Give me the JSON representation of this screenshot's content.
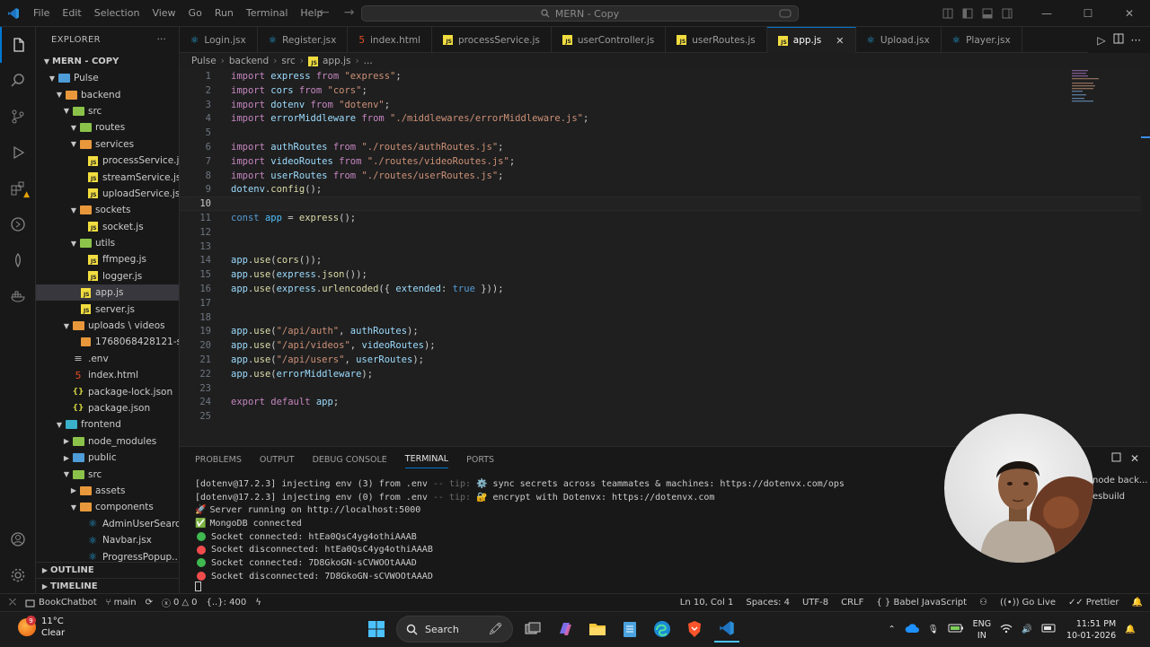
{
  "window": {
    "menu": [
      "File",
      "Edit",
      "Selection",
      "View",
      "Go",
      "Run",
      "Terminal",
      "Help"
    ],
    "search_text": "MERN - Copy"
  },
  "explorer": {
    "header": "EXPLORER",
    "root": "MERN - COPY",
    "rows": [
      {
        "label": "Pulse",
        "depth": 1,
        "type": "folder",
        "color": "blue",
        "open": true
      },
      {
        "label": "backend",
        "depth": 2,
        "type": "folder",
        "color": "orange",
        "open": true
      },
      {
        "label": "src",
        "depth": 3,
        "type": "folder",
        "color": "green",
        "open": true
      },
      {
        "label": "routes",
        "depth": 4,
        "type": "folder",
        "color": "green",
        "open": true
      },
      {
        "label": "services",
        "depth": 4,
        "type": "folder",
        "color": "orange",
        "open": true
      },
      {
        "label": "processService.js",
        "depth": 5,
        "type": "js"
      },
      {
        "label": "streamService.js",
        "depth": 5,
        "type": "js"
      },
      {
        "label": "uploadService.js",
        "depth": 5,
        "type": "js"
      },
      {
        "label": "sockets",
        "depth": 4,
        "type": "folder",
        "color": "orange",
        "open": true
      },
      {
        "label": "socket.js",
        "depth": 5,
        "type": "js"
      },
      {
        "label": "utils",
        "depth": 4,
        "type": "folder",
        "color": "green",
        "open": true
      },
      {
        "label": "ffmpeg.js",
        "depth": 5,
        "type": "js"
      },
      {
        "label": "logger.js",
        "depth": 5,
        "type": "js"
      },
      {
        "label": "app.js",
        "depth": 4,
        "type": "js",
        "selected": true
      },
      {
        "label": "server.js",
        "depth": 4,
        "type": "js"
      },
      {
        "label": "uploads \\ videos",
        "depth": 3,
        "type": "folder",
        "color": "orange",
        "open": true
      },
      {
        "label": "1768068428121-s...",
        "depth": 4,
        "type": "file"
      },
      {
        "label": ".env",
        "depth": 3,
        "type": "env"
      },
      {
        "label": "index.html",
        "depth": 3,
        "type": "html"
      },
      {
        "label": "package-lock.json",
        "depth": 3,
        "type": "json"
      },
      {
        "label": "package.json",
        "depth": 3,
        "type": "json"
      },
      {
        "label": "frontend",
        "depth": 2,
        "type": "folder",
        "color": "cyan",
        "open": true
      },
      {
        "label": "node_modules",
        "depth": 3,
        "type": "folder",
        "color": "green",
        "open": false
      },
      {
        "label": "public",
        "depth": 3,
        "type": "folder",
        "color": "blue",
        "open": false
      },
      {
        "label": "src",
        "depth": 3,
        "type": "folder",
        "color": "green",
        "open": true
      },
      {
        "label": "assets",
        "depth": 4,
        "type": "folder",
        "color": "orange",
        "open": false
      },
      {
        "label": "components",
        "depth": 4,
        "type": "folder",
        "color": "orange",
        "open": true
      },
      {
        "label": "AdminUserSearc...",
        "depth": 5,
        "type": "jsx"
      },
      {
        "label": "Navbar.jsx",
        "depth": 5,
        "type": "jsx"
      },
      {
        "label": "ProgressPopup...",
        "depth": 5,
        "type": "jsx"
      }
    ],
    "outline": "OUTLINE",
    "timeline": "TIMELINE"
  },
  "tabs": [
    {
      "label": "Login.jsx",
      "type": "jsx"
    },
    {
      "label": "Register.jsx",
      "type": "jsx"
    },
    {
      "label": "index.html",
      "type": "html"
    },
    {
      "label": "processService.js",
      "type": "js"
    },
    {
      "label": "userController.js",
      "type": "js"
    },
    {
      "label": "userRoutes.js",
      "type": "js"
    },
    {
      "label": "app.js",
      "type": "js",
      "active": true
    },
    {
      "label": "Upload.jsx",
      "type": "jsx"
    },
    {
      "label": "Player.jsx",
      "type": "jsx"
    }
  ],
  "breadcrumb": [
    "Pulse",
    "backend",
    "src",
    "app.js",
    "..."
  ],
  "editor": {
    "current_line": 10,
    "lines": [
      "1",
      "2",
      "3",
      "4",
      "5",
      "6",
      "7",
      "8",
      "9",
      "10",
      "11",
      "12",
      "13",
      "14",
      "15",
      "16",
      "17",
      "18",
      "19",
      "20",
      "21",
      "22",
      "23",
      "24",
      "25"
    ]
  },
  "panel": {
    "tabs": [
      "PROBLEMS",
      "OUTPUT",
      "DEBUG CONSOLE",
      "TERMINAL",
      "PORTS"
    ],
    "active_tab": "TERMINAL",
    "terminal": [
      {
        "prefix": "[dotenv@17.2.3] injecting env (3) from .env",
        "dim": " -- tip: ",
        "rest": "⚙️ sync secrets across teammates & machines: https://dotenvx.com/ops"
      },
      {
        "prefix": "[dotenv@17.2.3] injecting env (0) from .env",
        "dim": " -- tip: ",
        "rest": "🔐 encrypt with Dotenvx: https://dotenvx.com"
      },
      {
        "icon": "🚀",
        "text": "Server running on http://localhost:5000"
      },
      {
        "icon": "✅",
        "text": "MongoDB connected"
      },
      {
        "dot": "g",
        "text": "Socket connected: htEa0QsC4yg4othiAAAB"
      },
      {
        "dot": "r",
        "text": "Socket disconnected: htEa0QsC4yg4othiAAAB"
      },
      {
        "dot": "g",
        "text": "Socket connected: 7D8GkoGN-sCVWOOtAAAD"
      },
      {
        "dot": "r",
        "text": "Socket disconnected: 7D8GkoGN-sCVWOOtAAAD"
      }
    ],
    "side_items": [
      "node back...",
      "esbuild"
    ]
  },
  "statusbar": {
    "left": [
      "BookChatbot",
      "main",
      "0",
      "0",
      "{..}: 400"
    ],
    "right": [
      "Ln 10, Col 1",
      "Spaces: 4",
      "UTF-8",
      "CRLF",
      "{ } Babel JavaScript",
      "Go Live",
      "Prettier"
    ]
  },
  "taskbar": {
    "weather_temp": "11°C",
    "weather_desc": "Clear",
    "weather_badge": "9",
    "search_label": "Search",
    "lang": "ENG",
    "region": "IN",
    "time": "11:51 PM",
    "date": "10-01-2026"
  }
}
